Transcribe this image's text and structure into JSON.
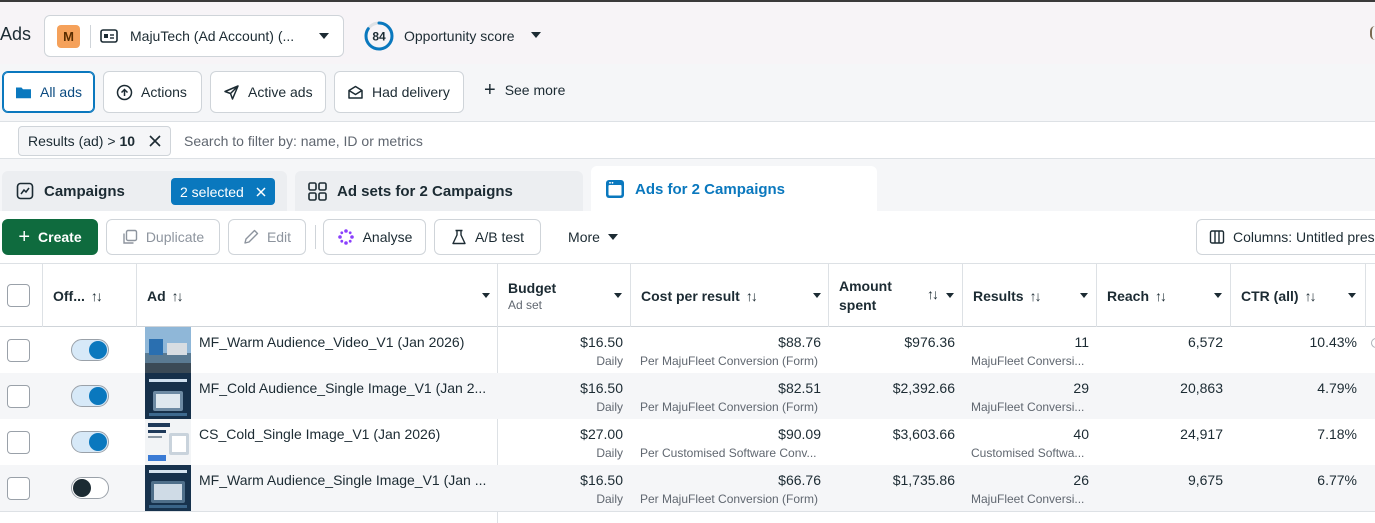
{
  "app": {
    "title": "Ads"
  },
  "account": {
    "avatar": "M",
    "name": "MajuTech (Ad Account) (..."
  },
  "opportunity": {
    "score": "84",
    "score_fraction": 0.84,
    "label": "Opportunity score"
  },
  "filters": {
    "chips": [
      {
        "label": "All ads",
        "icon": "folder-icon"
      },
      {
        "label": "Actions",
        "icon": "upload-circle-icon"
      },
      {
        "label": "Active ads",
        "icon": "send-icon"
      },
      {
        "label": "Had delivery",
        "icon": "envelope-icon"
      }
    ],
    "see_more": "See more"
  },
  "search": {
    "pill_label": "Results (ad) > ",
    "pill_value": "10",
    "placeholder": "Search to filter by: name, ID or metrics"
  },
  "level_tabs": {
    "campaigns": "Campaigns",
    "selected_badge": "2 selected",
    "adsets": "Ad sets for 2 Campaigns",
    "ads": "Ads for 2 Campaigns"
  },
  "toolbar": {
    "create": "Create",
    "duplicate": "Duplicate",
    "edit": "Edit",
    "analyse": "Analyse",
    "ab_test": "A/B test",
    "more": "More",
    "columns": "Columns: Untitled pres"
  },
  "table": {
    "headers": {
      "off": "Off...",
      "ad": "Ad",
      "budget": "Budget",
      "budget_sub": "Ad set",
      "cost": "Cost per result",
      "amount_line1": "Amount",
      "amount_line2": "spent",
      "results": "Results",
      "reach": "Reach",
      "ctr": "CTR (all)"
    },
    "rows": [
      {
        "on": true,
        "name": "MF_Warm Audience_Video_V1 (Jan 2026)",
        "budget": "$16.50",
        "budget_sub": "Daily",
        "cost": "$88.76",
        "cost_sub": "Per MajuFleet Conversion (Form)",
        "spent": "$976.36",
        "results": "11",
        "results_sub": "MajuFleet Conversi...",
        "reach": "6,572",
        "ctr": "10.43%"
      },
      {
        "on": true,
        "name": "MF_Cold Audience_Single Image_V1 (Jan 2...",
        "budget": "$16.50",
        "budget_sub": "Daily",
        "cost": "$82.51",
        "cost_sub": "Per MajuFleet Conversion (Form)",
        "spent": "$2,392.66",
        "results": "29",
        "results_sub": "MajuFleet Conversi...",
        "reach": "20,863",
        "ctr": "4.79%"
      },
      {
        "on": true,
        "name": "CS_Cold_Single Image_V1 (Jan 2026)",
        "budget": "$27.00",
        "budget_sub": "Daily",
        "cost": "$90.09",
        "cost_sub": "Per Customised Software Conv...",
        "spent": "$3,603.66",
        "results": "40",
        "results_sub": "Customised Softwa...",
        "reach": "24,917",
        "ctr": "7.18%"
      },
      {
        "on": false,
        "name": "MF_Warm Audience_Single Image_V1 (Jan ...",
        "budget": "$16.50",
        "budget_sub": "Daily",
        "cost": "$66.76",
        "cost_sub": "Per MajuFleet Conversion (Form)",
        "spent": "$1,735.86",
        "results": "26",
        "results_sub": "MajuFleet Conversi...",
        "reach": "9,675",
        "ctr": "6.77%"
      }
    ]
  },
  "colors": {
    "accent": "#0a78be",
    "primary_button": "#0f6b3e"
  }
}
